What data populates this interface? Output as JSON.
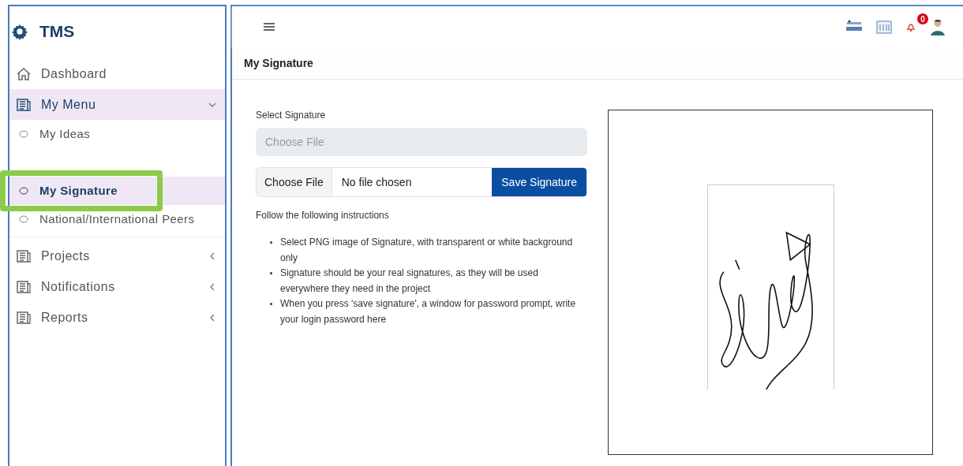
{
  "sidebar": {
    "brand": "TMS",
    "items": [
      {
        "kind": "link",
        "label": "Dashboard",
        "selected": false
      },
      {
        "kind": "group",
        "label": "My Menu",
        "expanded": true,
        "selected": true,
        "children": [
          {
            "label": "My Ideas",
            "selected": false
          },
          {
            "label": "My Signature",
            "selected": true,
            "highlighted": true
          },
          {
            "label": "National/International Peers",
            "selected": false
          }
        ]
      },
      {
        "kind": "group",
        "label": "Projects",
        "expanded": false,
        "selected": false
      },
      {
        "kind": "group",
        "label": "Notifications",
        "expanded": false,
        "selected": false
      },
      {
        "kind": "group",
        "label": "Reports",
        "expanded": false,
        "selected": false
      }
    ]
  },
  "topbar": {
    "notification_count": "0"
  },
  "page_title": "My Signature",
  "form": {
    "label": "Select Signature",
    "file_field": {
      "placeholder": "Choose File"
    },
    "file_button": "Choose File",
    "file_status": "No file chosen",
    "save_button": "Save Signature",
    "instructions_title": "Follow the following instructions",
    "instructions": [
      "Select PNG image of Signature, with transparent or white background only",
      "Signature should be your real signatures, as they will be used everywhere they need in the project",
      "When you press 'save signature', a window for password prompt, write your login password here"
    ]
  }
}
